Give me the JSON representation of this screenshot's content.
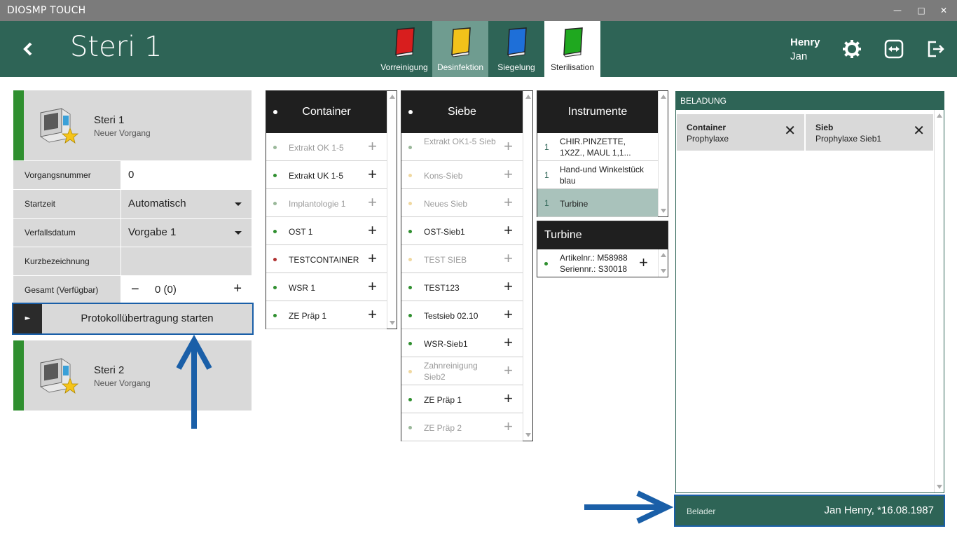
{
  "window": {
    "title": "DIOSMP TOUCH"
  },
  "header": {
    "title": "Steri 1",
    "tabs": [
      {
        "label": "Vorreinigung",
        "color": "#d81e1e",
        "active": false
      },
      {
        "label": "Desinfektion",
        "color": "#f2c21a",
        "active": true
      },
      {
        "label": "Siegelung",
        "color": "#1e6fd8",
        "active": false
      },
      {
        "label": "Sterilisation",
        "color": "#1fa81f",
        "active": false
      }
    ],
    "user": {
      "first": "Henry",
      "last": "Jan"
    }
  },
  "steris": [
    {
      "name": "Steri 1",
      "status": "Neuer Vorgang"
    },
    {
      "name": "Steri 2",
      "status": "Neuer Vorgang"
    }
  ],
  "form": {
    "vorgangsnummer": {
      "label": "Vorgangsnummer",
      "value": "0"
    },
    "startzeit": {
      "label": "Startzeit",
      "value": "Automatisch"
    },
    "verfallsdatum": {
      "label": "Verfallsdatum",
      "value": "Vorgabe 1"
    },
    "kurzbezeichnung": {
      "label": "Kurzbezeichnung",
      "value": ""
    },
    "gesamt": {
      "label": "Gesamt (Verfügbar)",
      "value": "0 (0)"
    }
  },
  "protocol_button": "Protokollübertragung starten",
  "container": {
    "header": "Container",
    "items": [
      {
        "label": "Extrakt OK 1-5",
        "dim": true,
        "dot": "#9ab89a"
      },
      {
        "label": "Extrakt UK 1-5",
        "dim": false,
        "dot": "#2f8f2f"
      },
      {
        "label": "Implantologie 1",
        "dim": true,
        "dot": "#9ab89a"
      },
      {
        "label": "OST 1",
        "dim": false,
        "dot": "#2f8f2f"
      },
      {
        "label": "TESTCONTAINER",
        "dim": false,
        "dot": "#b03030"
      },
      {
        "label": "WSR 1",
        "dim": false,
        "dot": "#2f8f2f"
      },
      {
        "label": "ZE Präp 1",
        "dim": false,
        "dot": "#2f8f2f"
      }
    ]
  },
  "siebe": {
    "header": "Siebe",
    "items": [
      {
        "label": "Extrakt OK1-5 Sieb",
        "dim": true,
        "dot": "#9ab89a"
      },
      {
        "label": "Kons-Sieb",
        "dim": true,
        "dot": "#f0d8a0"
      },
      {
        "label": "Neues Sieb",
        "dim": true,
        "dot": "#f0d8a0"
      },
      {
        "label": "OST-Sieb1",
        "dim": false,
        "dot": "#2f8f2f"
      },
      {
        "label": "TEST SIEB",
        "dim": true,
        "dot": "#f0d8a0"
      },
      {
        "label": "TEST123",
        "dim": false,
        "dot": "#2f8f2f"
      },
      {
        "label": "Testsieb 02.10",
        "dim": false,
        "dot": "#2f8f2f"
      },
      {
        "label": "WSR-Sieb1",
        "dim": false,
        "dot": "#2f8f2f"
      },
      {
        "label": "Zahnreinigung Sieb2",
        "dim": true,
        "dot": "#f0d8a0"
      },
      {
        "label": "ZE Präp 1",
        "dim": false,
        "dot": "#2f8f2f"
      },
      {
        "label": "ZE Präp 2",
        "dim": true,
        "dot": "#9ab89a"
      }
    ]
  },
  "instrumente": {
    "header": "Instrumente",
    "items": [
      {
        "count": "1",
        "label": "CHIR.PINZETTE, 1X2Z., MAUL 1,1...",
        "selected": false
      },
      {
        "count": "1",
        "label": "Hand-und Winkelstück blau",
        "selected": false
      },
      {
        "count": "1",
        "label": "Turbine",
        "selected": true
      }
    ]
  },
  "turbine": {
    "header": "Turbine",
    "artikel": "Artikelnr.: M58988",
    "serien": "Seriennr.: S30018"
  },
  "beladung": {
    "header": "BELADUNG",
    "cards": [
      {
        "title": "Container",
        "sub": "Prophylaxe"
      },
      {
        "title": "Sieb",
        "sub": "Prophylaxe Sieb1"
      }
    ]
  },
  "belader": {
    "label": "Belader",
    "value": "Jan Henry, *16.08.1987"
  }
}
